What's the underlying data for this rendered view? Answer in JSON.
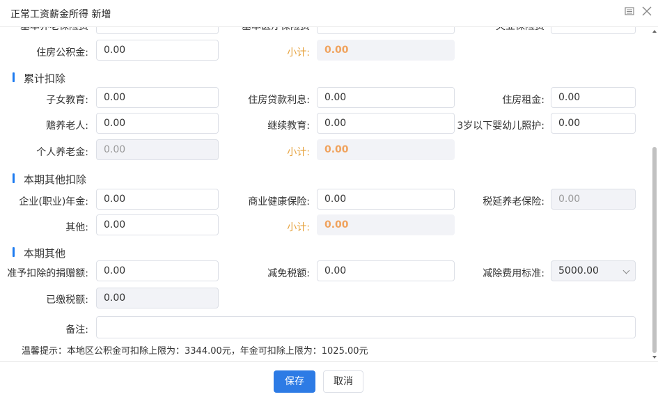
{
  "window": {
    "title": "正常工资薪金所得 新增",
    "icons": [
      "minimize-restore-icon",
      "close-icon"
    ]
  },
  "top_partial": {
    "label1": "基本养老保险费",
    "label2": "基本医疗保险费",
    "label3": "失业保险费"
  },
  "housing_fund": {
    "label": "住房公积金:",
    "value": "0.00",
    "subtotal_label": "小计:",
    "subtotal_value": "0.00"
  },
  "cumulative": {
    "title": "累计扣除",
    "children_edu_label": "子女教育:",
    "children_edu_value": "0.00",
    "loan_interest_label": "住房贷款利息:",
    "loan_interest_value": "0.00",
    "rent_label": "住房租金:",
    "rent_value": "0.00",
    "elderly_label": "赡养老人:",
    "elderly_value": "0.00",
    "continuing_edu_label": "继续教育:",
    "continuing_edu_value": "0.00",
    "infant_care_label": "3岁以下婴幼儿照护:",
    "infant_care_value": "0.00",
    "pension_label": "个人养老金:",
    "pension_value": "0.00",
    "subtotal_label": "小计:",
    "subtotal_value": "0.00"
  },
  "other_deductions": {
    "title": "本期其他扣除",
    "annuity_label": "企业(职业)年金:",
    "annuity_value": "0.00",
    "health_ins_label": "商业健康保险:",
    "health_ins_value": "0.00",
    "deferred_pension_label": "税延养老保险:",
    "deferred_pension_value": "0.00",
    "other_label": "其他:",
    "other_value": "0.00",
    "subtotal_label": "小计:",
    "subtotal_value": "0.00"
  },
  "period_other": {
    "title": "本期其他",
    "donation_label": "准予扣除的捐赠额:",
    "donation_value": "0.00",
    "tax_relief_label": "减免税额:",
    "tax_relief_value": "0.00",
    "standard_label": "减除费用标准:",
    "standard_value": "5000.00",
    "paid_tax_label": "已缴税额:",
    "paid_tax_value": "0.00",
    "remark_label": "备注:",
    "remark_value": ""
  },
  "tip": "温馨提示：本地区公积金可扣除上限为：3344.00元，年金可扣除上限为：1025.00元",
  "footer": {
    "save_label": "保存",
    "cancel_label": "取消"
  }
}
